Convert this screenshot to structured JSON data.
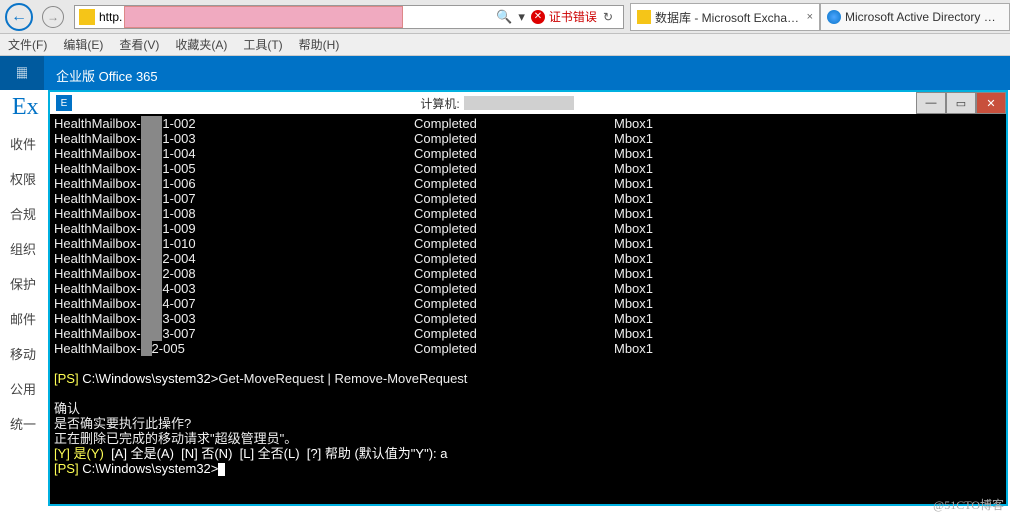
{
  "ie": {
    "address_prefix": "http.",
    "search_glyph": "🔍",
    "refresh_glyph": "↻",
    "cert_error": "证书错误",
    "tabs": [
      {
        "icon": "db",
        "label": "数据库 - Microsoft Excha…",
        "close": "×"
      },
      {
        "icon": "ie",
        "label": "Microsoft Active Directory …",
        "close": ""
      }
    ],
    "menu": [
      "文件(F)",
      "编辑(E)",
      "查看(V)",
      "收藏夹(A)",
      "工具(T)",
      "帮助(H)"
    ]
  },
  "o365": {
    "brand": "企业版   Office 365"
  },
  "exchange": {
    "logo": "Ex",
    "side_items": [
      "收件",
      "权限",
      "合规",
      "组织",
      "保护",
      "邮件",
      "移动",
      "公用",
      "统一"
    ]
  },
  "terminal": {
    "title_prefix": "计算机:",
    "rows": [
      {
        "name": "HealthMailbox-",
        "r": "      ",
        "suf": "1-002",
        "status": "Completed",
        "db": "Mbox1"
      },
      {
        "name": "HealthMailbox-",
        "r": "      ",
        "suf": "1-003",
        "status": "Completed",
        "db": "Mbox1"
      },
      {
        "name": "HealthMailbox-",
        "r": "      ",
        "suf": "1-004",
        "status": "Completed",
        "db": "Mbox1"
      },
      {
        "name": "HealthMailbox-",
        "r": "      ",
        "suf": "1-005",
        "status": "Completed",
        "db": "Mbox1"
      },
      {
        "name": "HealthMailbox-",
        "r": "      ",
        "suf": "1-006",
        "status": "Completed",
        "db": "Mbox1"
      },
      {
        "name": "HealthMailbox-",
        "r": "      ",
        "suf": "1-007",
        "status": "Completed",
        "db": "Mbox1"
      },
      {
        "name": "HealthMailbox-",
        "r": "      ",
        "suf": "1-008",
        "status": "Completed",
        "db": "Mbox1"
      },
      {
        "name": "HealthMailbox-",
        "r": "      ",
        "suf": "1-009",
        "status": "Completed",
        "db": "Mbox1"
      },
      {
        "name": "HealthMailbox-",
        "r": "      ",
        "suf": "1-010",
        "status": "Completed",
        "db": "Mbox1"
      },
      {
        "name": "HealthMailbox-",
        "r": "      ",
        "suf": "2-004",
        "status": "Completed",
        "db": "Mbox1"
      },
      {
        "name": "HealthMailbox-",
        "r": "      ",
        "suf": "2-008",
        "status": "Completed",
        "db": "Mbox1"
      },
      {
        "name": "HealthMailbox-",
        "r": "      ",
        "suf": "4-003",
        "status": "Completed",
        "db": "Mbox1"
      },
      {
        "name": "HealthMailbox-",
        "r": "      ",
        "suf": "4-007",
        "status": "Completed",
        "db": "Mbox1"
      },
      {
        "name": "HealthMailbox-",
        "r": "      ",
        "suf": "3-003",
        "status": "Completed",
        "db": "Mbox1"
      },
      {
        "name": "HealthMailbox-",
        "r": "      ",
        "suf": "3-007",
        "status": "Completed",
        "db": "Mbox1"
      },
      {
        "name": "HealthMailbox-",
        "r": "   ",
        "suf": "2-005",
        "status": "Completed",
        "db": "Mbox1"
      }
    ],
    "ps_prefix": "[PS]",
    "prompt_path": " C:\\Windows\\system32>",
    "cmd1": "Get-MoveRequest | Remove-MoveRequest",
    "confirm_title": "确认",
    "confirm_q": "是否确实要执行此操作?",
    "confirm_msg": "正在删除已完成的移动请求\"超级管理员\"。",
    "choice_line": "[Y] 是(Y)  [A] 全是(A)  [N] 否(N)  [L] 全否(L)  [?] 帮助 (默认值为\"Y\"): a",
    "choice_y": "[Y] 是(Y)",
    "choice_rest": "  [A] 全是(A)  [N] 否(N)  [L] 全否(L)  [?] 帮助 (默认值为\"Y\"): a"
  },
  "watermark": "@51CTO博客"
}
